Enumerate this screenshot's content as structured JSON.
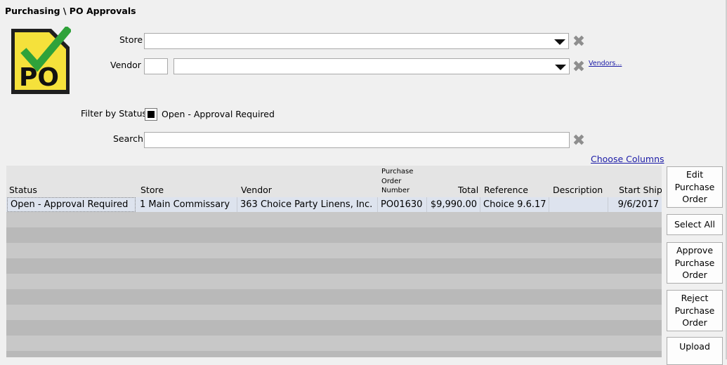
{
  "header": {
    "title": "Purchasing \\ PO Approvals"
  },
  "logo": {
    "text": "PO",
    "icon": "po-check-icon"
  },
  "filters": {
    "store_label": "Store",
    "store_value": "",
    "vendor_label": "Vendor",
    "vendor_code": "",
    "vendor_value": "",
    "vendors_link": "Vendors...",
    "filter_status_label": "Filter by Status",
    "filter_status_option": "Open - Approval Required",
    "filter_status_checked": true,
    "search_label": "Search",
    "search_value": "",
    "choose_columns": "Choose Columns"
  },
  "grid": {
    "columns": [
      "Status",
      "Store",
      "Vendor",
      "Purchase Order Number",
      "Total",
      "Reference",
      "Description",
      "Start Ship"
    ],
    "po_header_lines": [
      "Purchase",
      "Order",
      "Number"
    ],
    "rows": [
      {
        "status": "Open - Approval Required",
        "store": "1 Main Commissary",
        "vendor": "363 Choice Party Linens, Inc.",
        "po_number": "PO01630",
        "total": "$9,990.00",
        "reference": "Choice 9.6.17",
        "description": "",
        "start_ship": "9/6/2017"
      }
    ]
  },
  "actions": {
    "edit": "Edit Purchase Order",
    "select_all": "Select All",
    "approve": "Approve Purchase Order",
    "reject": "Reject Purchase Order",
    "upload": "Upload"
  },
  "colors": {
    "link": "#1a1aa6",
    "logo_yellow": "#f5e13b",
    "check_green": "#2fa23a",
    "selected_row": "#dde3ee"
  }
}
